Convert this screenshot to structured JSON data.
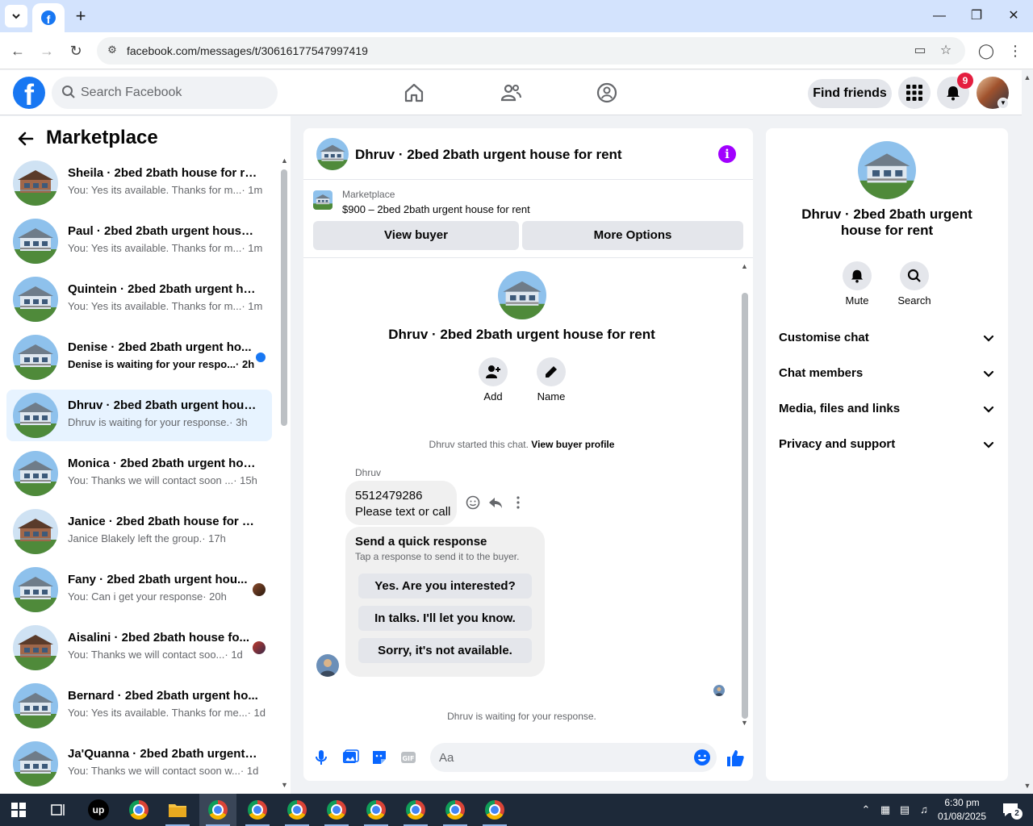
{
  "browser": {
    "url": "facebook.com/messages/t/30616177547997419"
  },
  "header": {
    "logo": "f",
    "search_placeholder": "Search Facebook",
    "find_friends": "Find friends",
    "notification_count": "9",
    "brand_color": "#1877f2"
  },
  "sidebar": {
    "title": "Marketplace",
    "conversations": [
      {
        "name": "Sheila · 2bed 2bath house for rent",
        "preview": "You: Yes its available. Thanks for m...",
        "time": " · 1m",
        "thumb": "brown",
        "unread": false
      },
      {
        "name": "Paul · 2bed 2bath urgent house ...",
        "preview": "You: Yes its available. Thanks for m...",
        "time": " · 1m",
        "thumb": "blue",
        "unread": false
      },
      {
        "name": "Quintein · 2bed 2bath urgent ho...",
        "preview": "You: Yes its available. Thanks for m...",
        "time": " · 1m",
        "thumb": "blue",
        "unread": false
      },
      {
        "name": "Denise · 2bed 2bath urgent ho...",
        "preview": "Denise is waiting for your respo...",
        "time": " · 2h",
        "thumb": "blue",
        "unread": true
      },
      {
        "name": "Dhruv · 2bed 2bath urgent hous...",
        "preview": "Dhruv is waiting for your response.",
        "time": " · 3h",
        "thumb": "blue",
        "unread": false,
        "active": true
      },
      {
        "name": "Monica · 2bed 2bath urgent hou...",
        "preview": "You: Thanks we will contact soon ...",
        "time": " · 15h",
        "thumb": "blue",
        "unread": false
      },
      {
        "name": "Janice · 2bed 2bath house for rent",
        "preview": "Janice Blakely left the group.",
        "time": " · 17h",
        "thumb": "brown",
        "unread": false
      },
      {
        "name": "Fany · 2bed 2bath urgent hou...",
        "preview": "You: Can i get your response",
        "time": " · 20h",
        "thumb": "blue",
        "unread": false,
        "seen": true
      },
      {
        "name": "Aisalini · 2bed 2bath house fo...",
        "preview": "You: Thanks we will contact soo...",
        "time": " · 1d",
        "thumb": "brown",
        "unread": false,
        "seen": true
      },
      {
        "name": "Bernard · 2bed 2bath urgent ho...",
        "preview": "You: Yes its available. Thanks for me...",
        "time": " · 1d",
        "thumb": "blue",
        "unread": false
      },
      {
        "name": "Ja'Quanna · 2bed 2bath urgent ...",
        "preview": "You: Thanks we will contact soon w...",
        "time": " · 1d",
        "thumb": "blue",
        "unread": false
      }
    ]
  },
  "chat": {
    "title": "Dhruv · 2bed 2bath urgent house for rent",
    "listing_label": "Marketplace",
    "listing_price": "$900 – 2bed 2bath urgent house for rent",
    "view_buyer": "View buyer",
    "more_options": "More Options",
    "intro_title": "Dhruv · 2bed 2bath urgent house for rent",
    "add_label": "Add",
    "name_label": "Name",
    "system_msg": "Dhruv started this chat.",
    "system_link": "View buyer profile",
    "sender": "Dhruv",
    "message_line1": "5512479286",
    "message_line2": "Please text or call",
    "quick_title": "Send a quick response",
    "quick_subtitle": "Tap a response to send it to the buyer.",
    "quick_replies": [
      "Yes. Are you interested?",
      "In talks. I'll let you know.",
      "Sorry, it's not available."
    ],
    "waiting": "Dhruv is waiting for your response.",
    "composer_placeholder": "Aa",
    "accent_color": "#a100ff"
  },
  "info_panel": {
    "name": "Dhruv · 2bed 2bath urgent house for rent",
    "mute": "Mute",
    "search": "Search",
    "sections": [
      "Customise chat",
      "Chat members",
      "Media, files and links",
      "Privacy and support"
    ]
  },
  "taskbar": {
    "time": "6:30 pm",
    "date": "01/08/2025",
    "notification_count": "2"
  }
}
